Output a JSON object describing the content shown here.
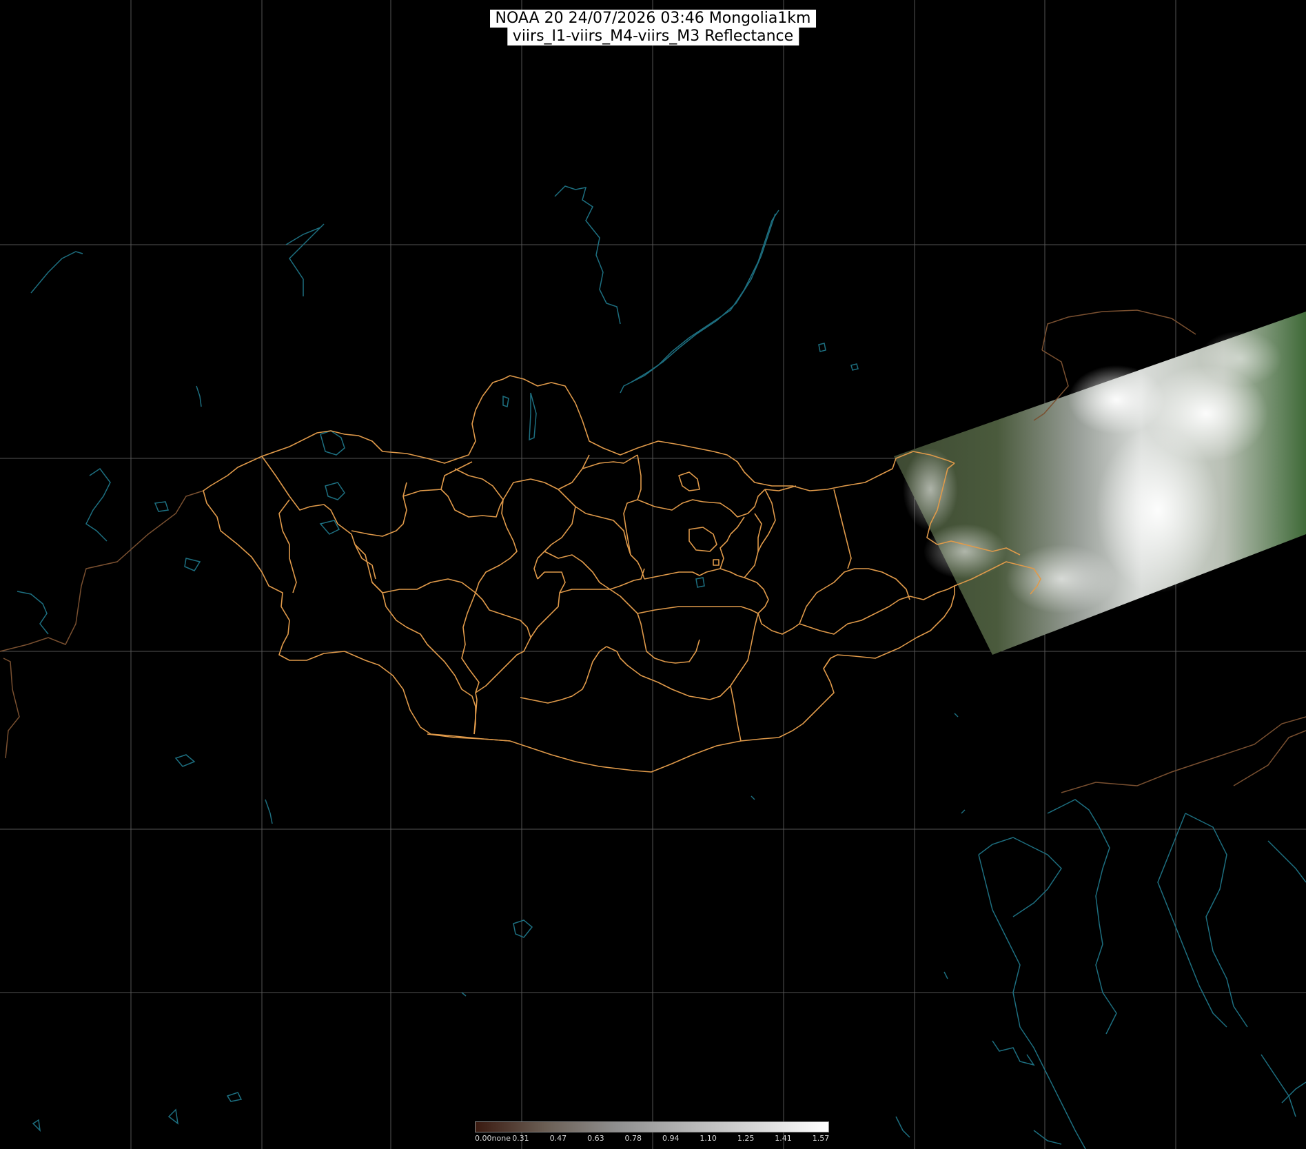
{
  "title": {
    "line1": "NOAA 20 24/07/2026 03:46 Mongolia1km",
    "line2": "viirs_I1-viirs_M4-viirs_M3 Reflectance"
  },
  "colorbar": {
    "labels": [
      "0.00none",
      "0.31",
      "0.47",
      "0.63",
      "0.78",
      "0.94",
      "1.10",
      "1.25",
      "1.41",
      "1.57"
    ],
    "colors": [
      "#3a1a10",
      "#6b5f55",
      "#8f8f8f",
      "#b5b5b5",
      "#d8d8d8",
      "#ffffff"
    ]
  },
  "colors": {
    "background": "#000000",
    "grid": "#555555",
    "province_border": "#e09a4a",
    "coastline": "#1d6f80",
    "national_border": "#7a5030"
  }
}
